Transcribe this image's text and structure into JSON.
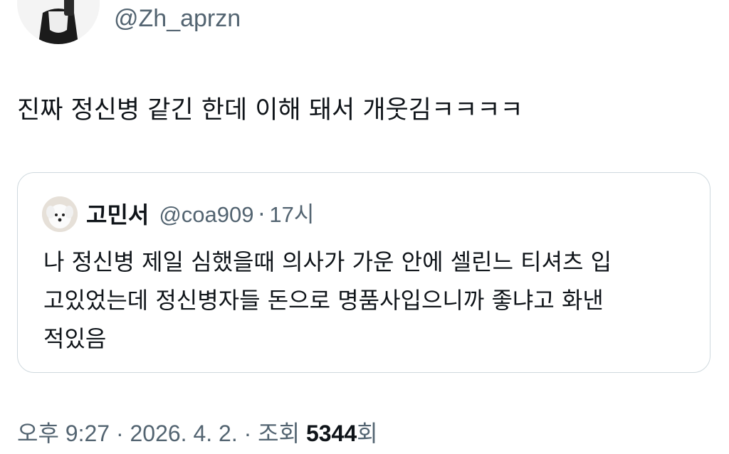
{
  "author": {
    "handle": "@Zh_aprzn"
  },
  "tweet": {
    "text": "진짜 정신병 같긴 한데 이해 돼서 개웃김ㅋㅋㅋㅋ"
  },
  "quoted_tweet": {
    "name": "고민서",
    "handle": "@coa909",
    "separator": "·",
    "time": "17시",
    "body_lines": [
      "나 정신병 제일 심했을때 의사가 가운 안에 셀린느 티셔츠 입",
      "고있었는데 정신병자들 돈으로 명품사입으니까 좋냐고 화낸",
      "적있음"
    ]
  },
  "meta": {
    "timestamp": "오후 9:27 · 2026. 4. 2. · 조회 ",
    "views": "5344",
    "views_unit": "회"
  }
}
